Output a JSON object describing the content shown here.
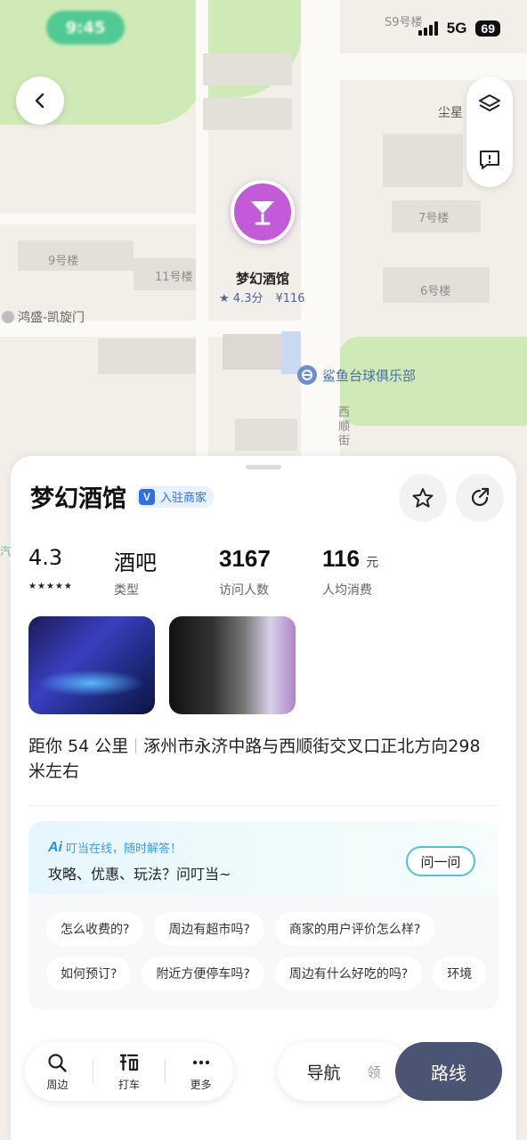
{
  "status_bar": {
    "time": "9:45",
    "network": "5G",
    "battery": "69"
  },
  "map": {
    "labels": {
      "building_s9": "S9号楼",
      "chenxing": "尘星",
      "building_7": "7号楼",
      "building_9": "9号楼",
      "building_11": "11号楼",
      "building_6": "6号楼",
      "hongsheng": "鸿盛-凯旋门",
      "xishun_street": "西顺街",
      "left_edge": "汽",
      "bottom_right": "领"
    },
    "poi": {
      "name": "梦幻酒馆",
      "rating": "4.3分",
      "price": "¥116"
    },
    "nearby_poi": {
      "name": "鲨鱼台球俱乐部"
    }
  },
  "sheet": {
    "title": "梦幻酒馆",
    "merchant_badge": "入驻商家",
    "stats": [
      {
        "value": "4.3",
        "label": ""
      },
      {
        "value": "酒吧",
        "label": "类型"
      },
      {
        "value": "3167",
        "label": "访问人数"
      },
      {
        "value": "116",
        "unit": "元",
        "label": "人均消费"
      }
    ],
    "address_distance": "距你 54 公里",
    "address_text": "涿州市永济中路与西顺街交叉口正北方向298米左右",
    "ai": {
      "status": "叮当在线，随时解答！",
      "prompt": "攻略、优惠、玩法？问叮当~",
      "ask_button": "问一问",
      "chips_row1": [
        "怎么收费的?",
        "周边有超市吗?",
        "商家的用户评价怎么样?"
      ],
      "chips_row2": [
        "如何预订?",
        "附近方便停车吗?",
        "周边有什么好吃的吗?",
        "环境"
      ]
    },
    "bottom": {
      "nearby": "周边",
      "taxi": "打车",
      "more": "更多",
      "navigate": "导航",
      "route": "路线"
    }
  },
  "colors": {
    "accent": "#2f6fe4",
    "marker": "#c35ad8",
    "route_button": "#4b5573"
  }
}
